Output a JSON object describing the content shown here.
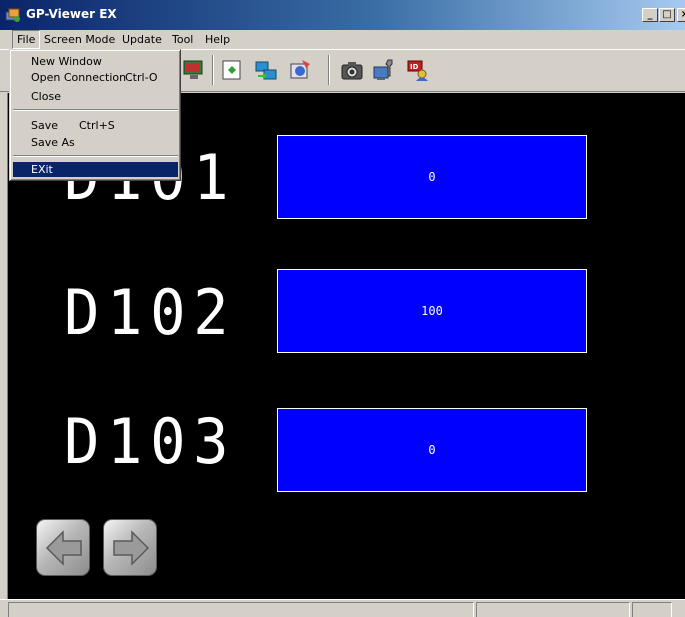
{
  "window": {
    "title": "GP-Viewer EX",
    "minimize_glyph": "_",
    "maximize_glyph": "□",
    "close_glyph": "×"
  },
  "menubar": {
    "items": [
      "File",
      "Screen Mode",
      "Update",
      "Tool",
      "Help"
    ]
  },
  "file_menu": {
    "new_window": "New Window",
    "open_connection": "Open Connection",
    "open_connection_shortcut": "Ctrl-O",
    "close": "Close",
    "save": "Save",
    "save_shortcut": "Ctrl+S",
    "save_as": "Save As",
    "exit": "EXit",
    "highlighted_item": "EXit"
  },
  "toolbar": {
    "icons": [
      "monitor-icon",
      "transfer-icon",
      "sync-icon",
      "image-icon",
      "camera-icon",
      "tools-icon",
      "id-card-icon"
    ]
  },
  "screen": {
    "devices": [
      {
        "label": "D101",
        "value": "0"
      },
      {
        "label": "D102",
        "value": "100"
      },
      {
        "label": "D103",
        "value": "0"
      }
    ],
    "nav": {
      "prev_icon": "arrow-left-icon",
      "next_icon": "arrow-right-icon"
    }
  },
  "colors": {
    "title_bar": "#0a246a",
    "chrome": "#d4d0c8",
    "screen_bg": "#000000",
    "value_box": "#0000ff",
    "label_text": "#ffffff",
    "menu_highlight": "#0a246a"
  }
}
